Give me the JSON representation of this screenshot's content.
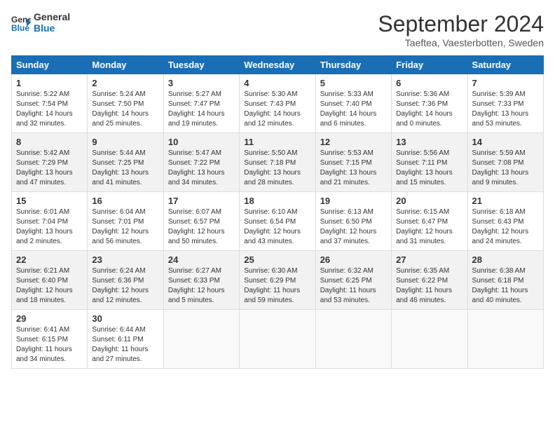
{
  "header": {
    "logo_line1": "General",
    "logo_line2": "Blue",
    "title": "September 2024",
    "subtitle": "Taeftea, Vaesterbotten, Sweden"
  },
  "weekdays": [
    "Sunday",
    "Monday",
    "Tuesday",
    "Wednesday",
    "Thursday",
    "Friday",
    "Saturday"
  ],
  "weeks": [
    [
      {
        "day": "1",
        "text": "Sunrise: 5:22 AM\nSunset: 7:54 PM\nDaylight: 14 hours\nand 32 minutes."
      },
      {
        "day": "2",
        "text": "Sunrise: 5:24 AM\nSunset: 7:50 PM\nDaylight: 14 hours\nand 25 minutes."
      },
      {
        "day": "3",
        "text": "Sunrise: 5:27 AM\nSunset: 7:47 PM\nDaylight: 14 hours\nand 19 minutes."
      },
      {
        "day": "4",
        "text": "Sunrise: 5:30 AM\nSunset: 7:43 PM\nDaylight: 14 hours\nand 12 minutes."
      },
      {
        "day": "5",
        "text": "Sunrise: 5:33 AM\nSunset: 7:40 PM\nDaylight: 14 hours\nand 6 minutes."
      },
      {
        "day": "6",
        "text": "Sunrise: 5:36 AM\nSunset: 7:36 PM\nDaylight: 14 hours\nand 0 minutes."
      },
      {
        "day": "7",
        "text": "Sunrise: 5:39 AM\nSunset: 7:33 PM\nDaylight: 13 hours\nand 53 minutes."
      }
    ],
    [
      {
        "day": "8",
        "text": "Sunrise: 5:42 AM\nSunset: 7:29 PM\nDaylight: 13 hours\nand 47 minutes."
      },
      {
        "day": "9",
        "text": "Sunrise: 5:44 AM\nSunset: 7:25 PM\nDaylight: 13 hours\nand 41 minutes."
      },
      {
        "day": "10",
        "text": "Sunrise: 5:47 AM\nSunset: 7:22 PM\nDaylight: 13 hours\nand 34 minutes."
      },
      {
        "day": "11",
        "text": "Sunrise: 5:50 AM\nSunset: 7:18 PM\nDaylight: 13 hours\nand 28 minutes."
      },
      {
        "day": "12",
        "text": "Sunrise: 5:53 AM\nSunset: 7:15 PM\nDaylight: 13 hours\nand 21 minutes."
      },
      {
        "day": "13",
        "text": "Sunrise: 5:56 AM\nSunset: 7:11 PM\nDaylight: 13 hours\nand 15 minutes."
      },
      {
        "day": "14",
        "text": "Sunrise: 5:59 AM\nSunset: 7:08 PM\nDaylight: 13 hours\nand 9 minutes."
      }
    ],
    [
      {
        "day": "15",
        "text": "Sunrise: 6:01 AM\nSunset: 7:04 PM\nDaylight: 13 hours\nand 2 minutes."
      },
      {
        "day": "16",
        "text": "Sunrise: 6:04 AM\nSunset: 7:01 PM\nDaylight: 12 hours\nand 56 minutes."
      },
      {
        "day": "17",
        "text": "Sunrise: 6:07 AM\nSunset: 6:57 PM\nDaylight: 12 hours\nand 50 minutes."
      },
      {
        "day": "18",
        "text": "Sunrise: 6:10 AM\nSunset: 6:54 PM\nDaylight: 12 hours\nand 43 minutes."
      },
      {
        "day": "19",
        "text": "Sunrise: 6:13 AM\nSunset: 6:50 PM\nDaylight: 12 hours\nand 37 minutes."
      },
      {
        "day": "20",
        "text": "Sunrise: 6:15 AM\nSunset: 6:47 PM\nDaylight: 12 hours\nand 31 minutes."
      },
      {
        "day": "21",
        "text": "Sunrise: 6:18 AM\nSunset: 6:43 PM\nDaylight: 12 hours\nand 24 minutes."
      }
    ],
    [
      {
        "day": "22",
        "text": "Sunrise: 6:21 AM\nSunset: 6:40 PM\nDaylight: 12 hours\nand 18 minutes."
      },
      {
        "day": "23",
        "text": "Sunrise: 6:24 AM\nSunset: 6:36 PM\nDaylight: 12 hours\nand 12 minutes."
      },
      {
        "day": "24",
        "text": "Sunrise: 6:27 AM\nSunset: 6:33 PM\nDaylight: 12 hours\nand 5 minutes."
      },
      {
        "day": "25",
        "text": "Sunrise: 6:30 AM\nSunset: 6:29 PM\nDaylight: 11 hours\nand 59 minutes."
      },
      {
        "day": "26",
        "text": "Sunrise: 6:32 AM\nSunset: 6:25 PM\nDaylight: 11 hours\nand 53 minutes."
      },
      {
        "day": "27",
        "text": "Sunrise: 6:35 AM\nSunset: 6:22 PM\nDaylight: 11 hours\nand 46 minutes."
      },
      {
        "day": "28",
        "text": "Sunrise: 6:38 AM\nSunset: 6:18 PM\nDaylight: 11 hours\nand 40 minutes."
      }
    ],
    [
      {
        "day": "29",
        "text": "Sunrise: 6:41 AM\nSunset: 6:15 PM\nDaylight: 11 hours\nand 34 minutes."
      },
      {
        "day": "30",
        "text": "Sunrise: 6:44 AM\nSunset: 6:11 PM\nDaylight: 11 hours\nand 27 minutes."
      },
      {
        "day": "",
        "text": ""
      },
      {
        "day": "",
        "text": ""
      },
      {
        "day": "",
        "text": ""
      },
      {
        "day": "",
        "text": ""
      },
      {
        "day": "",
        "text": ""
      }
    ]
  ]
}
